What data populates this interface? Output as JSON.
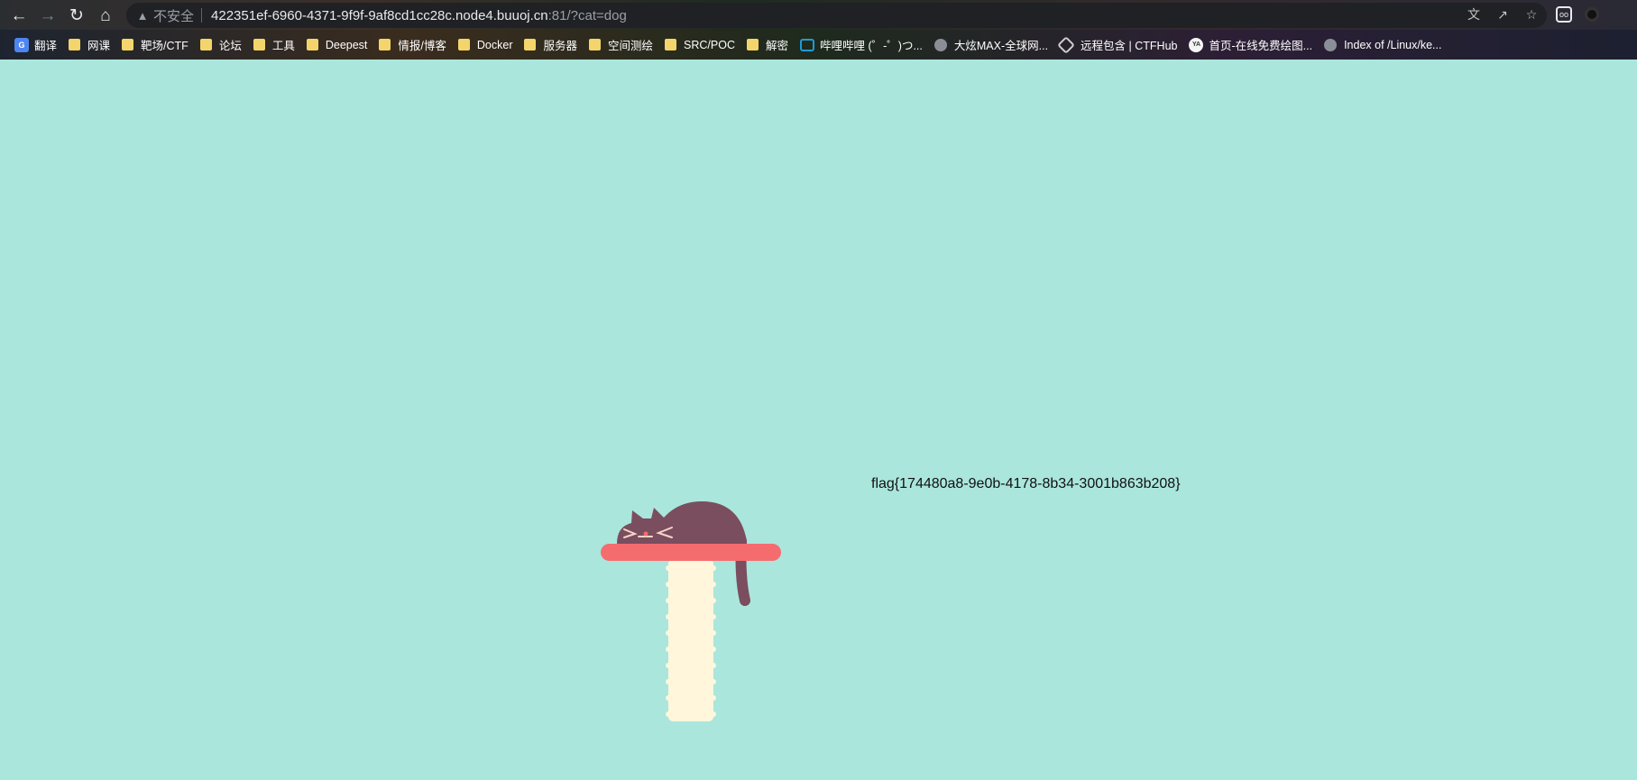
{
  "browser": {
    "nav": {
      "back_icon": "arrow-left-icon",
      "forward_icon": "arrow-right-icon",
      "reload_icon": "reload-icon",
      "home_icon": "home-icon"
    },
    "omnibox": {
      "security_label": "不安全",
      "host": "422351ef-6960-4371-9f9f-9af8cd1cc28c.node4.buuoj.cn",
      "path": ":81/?cat=dog"
    },
    "bookmarks": [
      {
        "label": "翻译",
        "icon": "google-translate-icon"
      },
      {
        "label": "网课",
        "icon": "folder-icon"
      },
      {
        "label": "靶场/CTF",
        "icon": "folder-icon"
      },
      {
        "label": "论坛",
        "icon": "folder-icon"
      },
      {
        "label": "工具",
        "icon": "folder-icon"
      },
      {
        "label": "Deepest",
        "icon": "folder-icon"
      },
      {
        "label": "情报/博客",
        "icon": "folder-icon"
      },
      {
        "label": "Docker",
        "icon": "folder-icon"
      },
      {
        "label": "服务器",
        "icon": "folder-icon"
      },
      {
        "label": "空间测绘",
        "icon": "folder-icon"
      },
      {
        "label": "SRC/POC",
        "icon": "folder-icon"
      },
      {
        "label": "解密",
        "icon": "folder-icon"
      },
      {
        "label": "哔哩哔哩 (゜-゜)つ...",
        "icon": "bilibili-icon"
      },
      {
        "label": "大炫MAX-全球网...",
        "icon": "globe-icon"
      },
      {
        "label": "远程包含 | CTFHub",
        "icon": "ctfhub-icon"
      },
      {
        "label": "首页-在线免费绘图...",
        "icon": "ya-icon"
      },
      {
        "label": "Index of /Linux/ke...",
        "icon": "globe-icon"
      }
    ]
  },
  "page": {
    "flag": "flag{174480a8-9e0b-4178-8b34-3001b863b208}",
    "colors": {
      "background": "#aae6dc",
      "cat": "#7a4e5e",
      "shelf": "#f56c6f",
      "post": "#fff6dc"
    }
  }
}
